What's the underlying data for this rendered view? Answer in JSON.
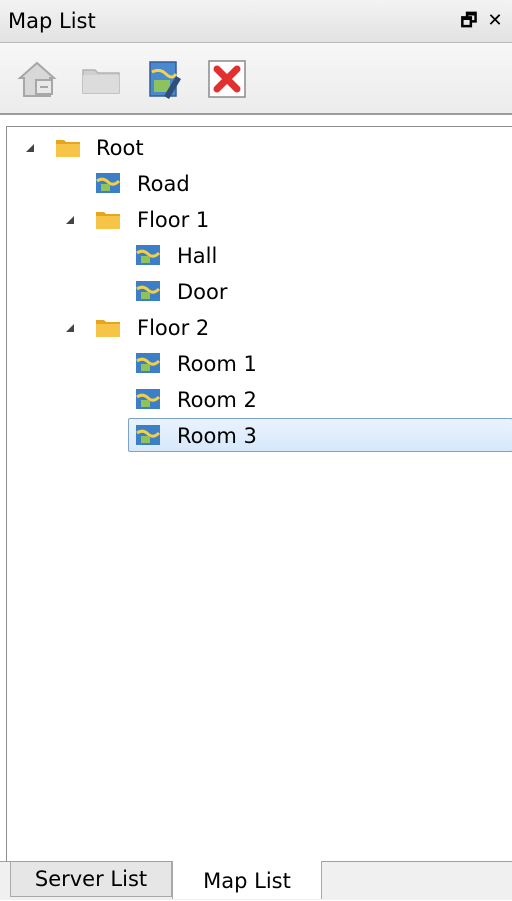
{
  "window": {
    "title": "Map List",
    "float_icon": "float-window-icon",
    "close_icon": "close-icon",
    "float_glyph": "🗗",
    "close_glyph": "✕"
  },
  "toolbar": {
    "items": [
      {
        "name": "add-map-button",
        "icon": "house-map-icon",
        "enabled": false
      },
      {
        "name": "add-folder-button",
        "icon": "folder-icon",
        "enabled": false
      },
      {
        "name": "edit-map-button",
        "icon": "map-edit-icon",
        "enabled": true
      },
      {
        "name": "delete-button",
        "icon": "red-x-icon",
        "enabled": true
      }
    ]
  },
  "tree": {
    "nodes": [
      {
        "label": "Root",
        "type": "folder",
        "expanded": true,
        "level": 0
      },
      {
        "label": "Road",
        "type": "map",
        "level": 1
      },
      {
        "label": "Floor 1",
        "type": "folder",
        "expanded": true,
        "level": 1
      },
      {
        "label": "Hall",
        "type": "map",
        "level": 2
      },
      {
        "label": "Door",
        "type": "map",
        "level": 2
      },
      {
        "label": "Floor 2",
        "type": "folder",
        "expanded": true,
        "level": 1
      },
      {
        "label": "Room 1",
        "type": "map",
        "level": 2
      },
      {
        "label": "Room 2",
        "type": "map",
        "level": 2
      },
      {
        "label": "Room 3",
        "type": "map",
        "level": 2,
        "selected": true
      }
    ]
  },
  "tabs": [
    {
      "label": "Server List",
      "active": false
    },
    {
      "label": "Map List",
      "active": true
    }
  ],
  "colors": {
    "folder": "#f2b62e",
    "map_blue": "#3c7fc6",
    "delete_red": "#e23030",
    "selection_border": "#7da2ce"
  }
}
